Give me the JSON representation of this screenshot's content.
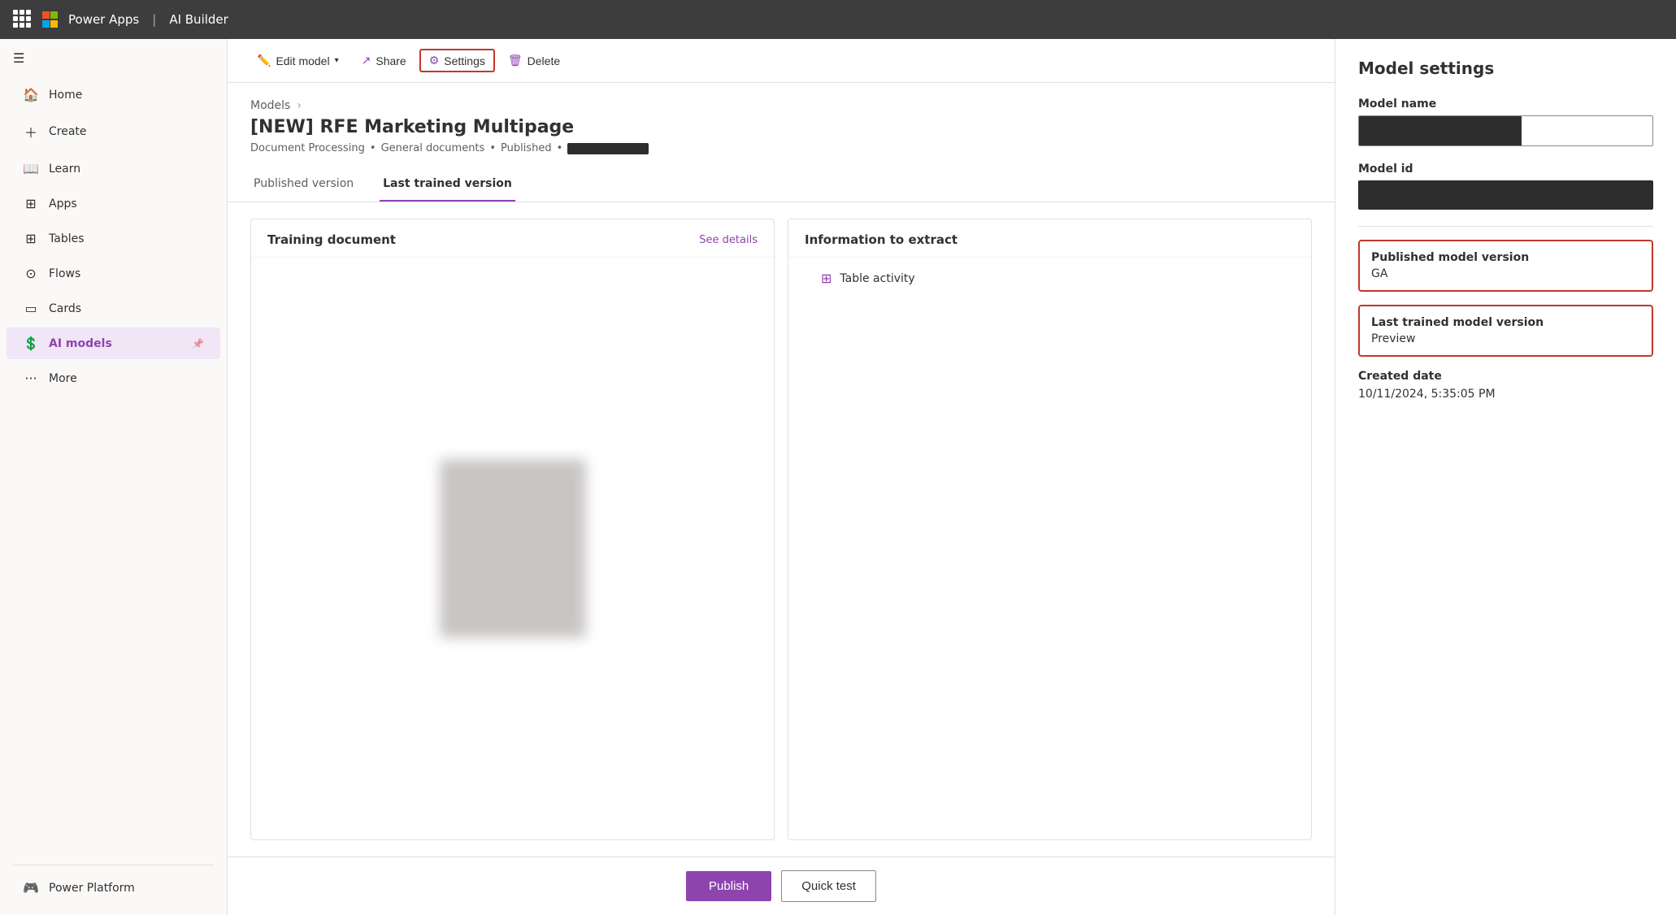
{
  "topbar": {
    "app_name": "Power Apps",
    "separator": "|",
    "product": "AI Builder"
  },
  "sidebar": {
    "items": [
      {
        "id": "home",
        "label": "Home",
        "icon": "🏠"
      },
      {
        "id": "create",
        "label": "Create",
        "icon": "＋"
      },
      {
        "id": "learn",
        "label": "Learn",
        "icon": "📖"
      },
      {
        "id": "apps",
        "label": "Apps",
        "icon": "⊞"
      },
      {
        "id": "tables",
        "label": "Tables",
        "icon": "⊞"
      },
      {
        "id": "flows",
        "label": "Flows",
        "icon": "⊙"
      },
      {
        "id": "cards",
        "label": "Cards",
        "icon": "▭"
      },
      {
        "id": "ai_models",
        "label": "AI models",
        "icon": "💲",
        "active": true
      },
      {
        "id": "more",
        "label": "More",
        "icon": "···"
      }
    ],
    "bottom_item": {
      "id": "power_platform",
      "label": "Power Platform",
      "icon": "🎮"
    }
  },
  "toolbar": {
    "edit_model_label": "Edit model",
    "share_label": "Share",
    "settings_label": "Settings",
    "delete_label": "Delete"
  },
  "page": {
    "breadcrumb_models": "Models",
    "title": "[NEW] RFE Marketing Multipage",
    "meta_doc_processing": "Document Processing",
    "meta_separator1": "•",
    "meta_general_docs": "General documents",
    "meta_separator2": "•",
    "meta_published": "Published",
    "meta_separator3": "•"
  },
  "tabs": {
    "published_version": "Published version",
    "last_trained_version": "Last trained version"
  },
  "training_panel": {
    "title": "Training document",
    "link": "See details"
  },
  "extract_panel": {
    "title": "Information to extract",
    "item_icon": "⊞",
    "item_label": "Table activity"
  },
  "actions": {
    "publish": "Publish",
    "quick_test": "Quick test"
  },
  "settings_panel": {
    "title": "Model settings",
    "model_name_label": "Model name",
    "model_id_label": "Model id",
    "published_version_label": "Published model version",
    "published_version_value": "GA",
    "last_trained_label": "Last trained model version",
    "last_trained_value": "Preview",
    "created_date_label": "Created date",
    "created_date_value": "10/11/2024, 5:35:05 PM"
  }
}
